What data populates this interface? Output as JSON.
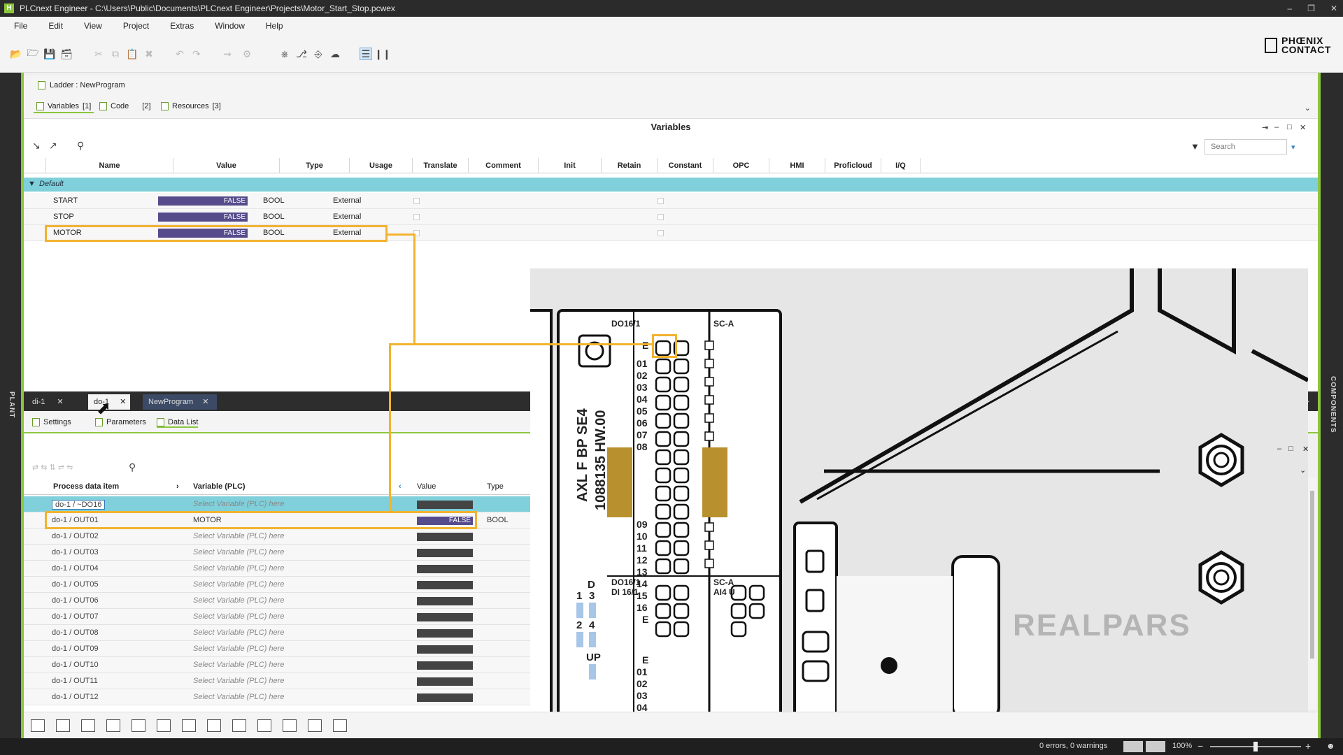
{
  "app": {
    "title": "PLCnext Engineer - C:\\Users\\Public\\Documents\\PLCnext Engineer\\Projects\\Motor_Start_Stop.pcwex",
    "icon_letter": "H",
    "brand_line1": "PHŒNIX",
    "brand_line2": "CONTACT"
  },
  "menu": [
    "File",
    "Edit",
    "View",
    "Project",
    "Extras",
    "Window",
    "Help"
  ],
  "sides": {
    "left": "PLANT",
    "right": "COMPONENTS"
  },
  "editor": {
    "title": "Ladder : NewProgram",
    "tabs": [
      {
        "label": "Variables",
        "count": "[1]"
      },
      {
        "label": "Code",
        "count": "[2]"
      },
      {
        "label": "Resources",
        "count": "[3]"
      }
    ],
    "panel_title": "Variables",
    "search_placeholder": "Search"
  },
  "variables": {
    "columns": [
      "Name",
      "Value",
      "Type",
      "Usage",
      "Translate",
      "Comment",
      "Init",
      "Retain",
      "Constant",
      "OPC",
      "HMI",
      "Proficloud",
      "I/Q"
    ],
    "group": "Default",
    "rows": [
      {
        "name": "START",
        "value": "FALSE",
        "type": "BOOL",
        "usage": "External"
      },
      {
        "name": "STOP",
        "value": "FALSE",
        "type": "BOOL",
        "usage": "External"
      },
      {
        "name": "MOTOR",
        "value": "FALSE",
        "type": "BOOL",
        "usage": "External"
      }
    ]
  },
  "lower": {
    "doc_tabs": [
      {
        "label": "di-1",
        "active": false
      },
      {
        "label": "do-1",
        "active": true
      },
      {
        "label": "NewProgram",
        "active": false
      }
    ],
    "sub_tabs": [
      "Settings",
      "Parameters",
      "Data List"
    ],
    "columns": [
      "Process data item",
      "Variable (PLC)",
      "Value",
      "Type"
    ],
    "rows": [
      {
        "item": "do-1 / ~DO16",
        "variable": "Select Variable (PLC) here",
        "value": "",
        "type": ""
      },
      {
        "item": "do-1 / OUT01",
        "variable": "MOTOR",
        "value": "FALSE",
        "type": "BOOL"
      },
      {
        "item": "do-1 / OUT02",
        "variable": "Select Variable (PLC) here",
        "value": "",
        "type": ""
      },
      {
        "item": "do-1 / OUT03",
        "variable": "Select Variable (PLC) here",
        "value": "",
        "type": ""
      },
      {
        "item": "do-1 / OUT04",
        "variable": "Select Variable (PLC) here",
        "value": "",
        "type": ""
      },
      {
        "item": "do-1 / OUT05",
        "variable": "Select Variable (PLC) here",
        "value": "",
        "type": ""
      },
      {
        "item": "do-1 / OUT06",
        "variable": "Select Variable (PLC) here",
        "value": "",
        "type": ""
      },
      {
        "item": "do-1 / OUT07",
        "variable": "Select Variable (PLC) here",
        "value": "",
        "type": ""
      },
      {
        "item": "do-1 / OUT08",
        "variable": "Select Variable (PLC) here",
        "value": "",
        "type": ""
      },
      {
        "item": "do-1 / OUT09",
        "variable": "Select Variable (PLC) here",
        "value": "",
        "type": ""
      },
      {
        "item": "do-1 / OUT10",
        "variable": "Select Variable (PLC) here",
        "value": "",
        "type": ""
      },
      {
        "item": "do-1 / OUT11",
        "variable": "Select Variable (PLC) here",
        "value": "",
        "type": ""
      },
      {
        "item": "do-1 / OUT12",
        "variable": "Select Variable (PLC) here",
        "value": "",
        "type": ""
      }
    ]
  },
  "hardware": {
    "module_label": "DO16/1",
    "side_label": "SC-A",
    "vertical_text_1": "AXL F BP SE4",
    "vertical_text_2": "1088135 HW.00",
    "lower_module": "DI 16/1",
    "lower_side": "AI4 U",
    "lower_module_top": "DO16/1",
    "lower_side_top": "SC-A",
    "terminals_left": [
      "E",
      "01",
      "02",
      "03",
      "04",
      "05",
      "06",
      "07",
      "08"
    ],
    "terminals_left2": [
      "09",
      "10",
      "11",
      "12",
      "13",
      "14",
      "15",
      "16",
      "E"
    ],
    "terminals_di": [
      "E",
      "01",
      "02",
      "03",
      "04"
    ],
    "led_d": "D",
    "led_1": "1",
    "led_3": "3",
    "led_2": "2",
    "led_4": "4",
    "led_up": "UP",
    "watermark": "REALPARS"
  },
  "status": {
    "messages": "0 errors, 0 warnings",
    "zoom": "100%"
  },
  "colors": {
    "accent": "#8cc63f",
    "highlight": "#f2b32f",
    "value_bar": "#564c8c",
    "group_row": "#7fd0da"
  }
}
